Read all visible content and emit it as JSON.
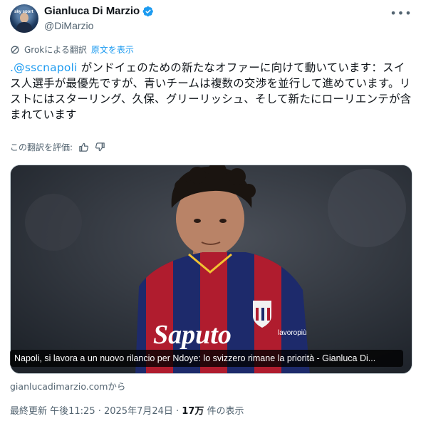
{
  "author": {
    "display_name": "Gianluca Di Marzio",
    "handle": "@DiMarzio",
    "avatar_label": "sky sport",
    "verified_icon": "verified-badge-icon"
  },
  "translation": {
    "label": "Grokによる翻訳",
    "show_original": "原文を表示"
  },
  "tweet": {
    "mention": ".@sscnapoli",
    "text_after_mention": " がンドイェのための新たなオファーに向けて動いています：スイス人選手が最優先ですが、青いチームは複数の交渉を並行して進めています。リストにはスターリング、久保、グリーリッシュ、そして新たにローリエンテが含まれています"
  },
  "rating": {
    "label": "この翻訳を評価:"
  },
  "media": {
    "caption": "Napoli, si lavora a un nuovo rilancio per Ndoye: lo svizzero rimane la priorità - Gianluca Di...",
    "jersey_sponsor": "Saputo",
    "jersey_brand": "lavoropiù"
  },
  "link_source": "gianlucadimarzio.comから",
  "meta": {
    "prefix": "最終更新 午後11:25 · 2025年7月24日 · ",
    "views_count": "17万",
    "views_suffix": " 件の表示"
  },
  "colors": {
    "accent": "#1d9bf0",
    "secondary_text": "#536471",
    "primary_text": "#0f1419"
  }
}
